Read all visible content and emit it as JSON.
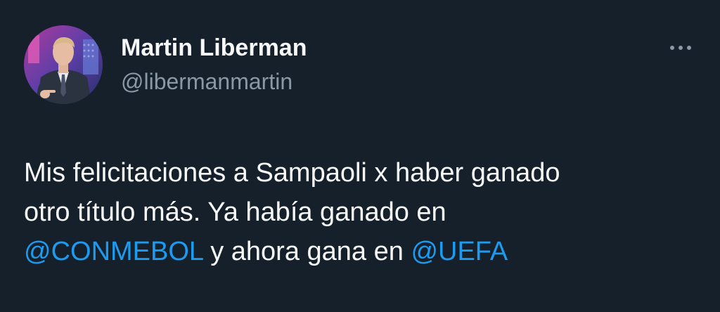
{
  "author": {
    "name": "Martin Liberman",
    "handle": "@libermanmartin",
    "avatar_icon": "profile-photo"
  },
  "menu": {
    "icon": "more-horizontal-icon"
  },
  "tweet": {
    "line1": "Mis felicitaciones a Sampaoli x haber ganado",
    "line2": "otro título más. Ya había ganado en",
    "mention1": "@CONMEBOL",
    "middle": " y ahora gana en ",
    "mention2": "@UEFA"
  },
  "colors": {
    "background": "#15202b",
    "text": "#f7f9f9",
    "secondary": "#8b98a5",
    "link": "#1d9bf0"
  }
}
